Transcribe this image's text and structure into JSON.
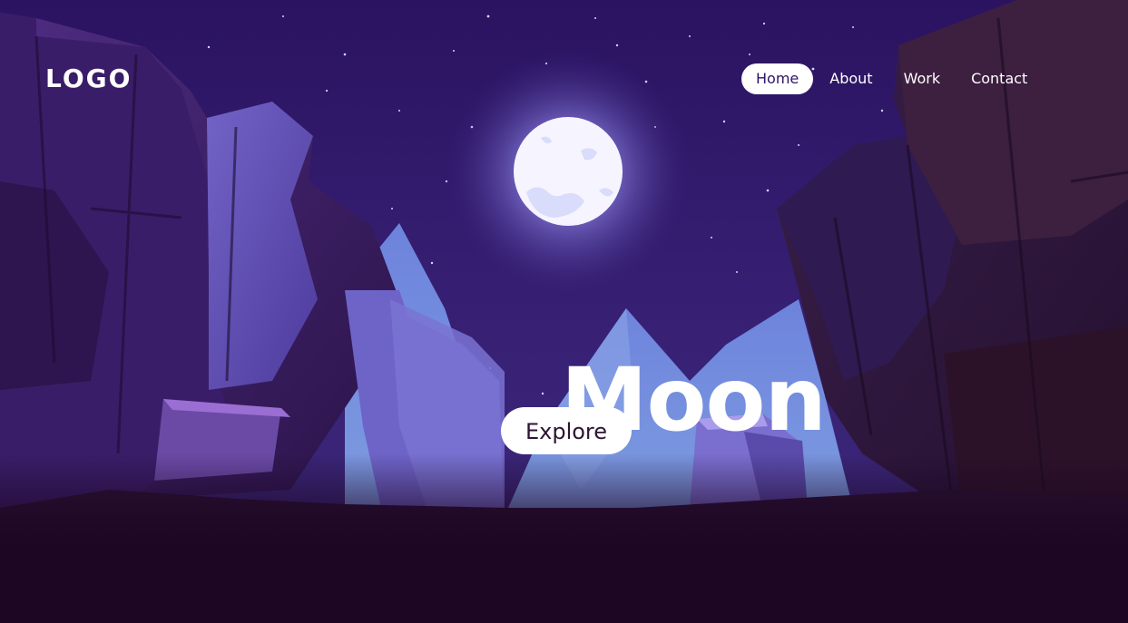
{
  "logo": {
    "text": "LOGO"
  },
  "nav": {
    "items": [
      {
        "label": "Home",
        "active": true
      },
      {
        "label": "About",
        "active": false
      },
      {
        "label": "Work",
        "active": false
      },
      {
        "label": "Contact",
        "active": false
      }
    ]
  },
  "hero": {
    "title": "Moon",
    "cta_label": "Explore"
  },
  "colors": {
    "sky": "#2d1566",
    "ground": "#1c0624",
    "moon": "#f4f1ff",
    "mountain": "#6a80d6",
    "cliff_left": "#4a2d84",
    "cliff_right": "#2e1540",
    "button_bg": "#ffffff",
    "text": "#ffffff"
  },
  "background": {
    "description_icon": "night-canyon-illustration"
  }
}
